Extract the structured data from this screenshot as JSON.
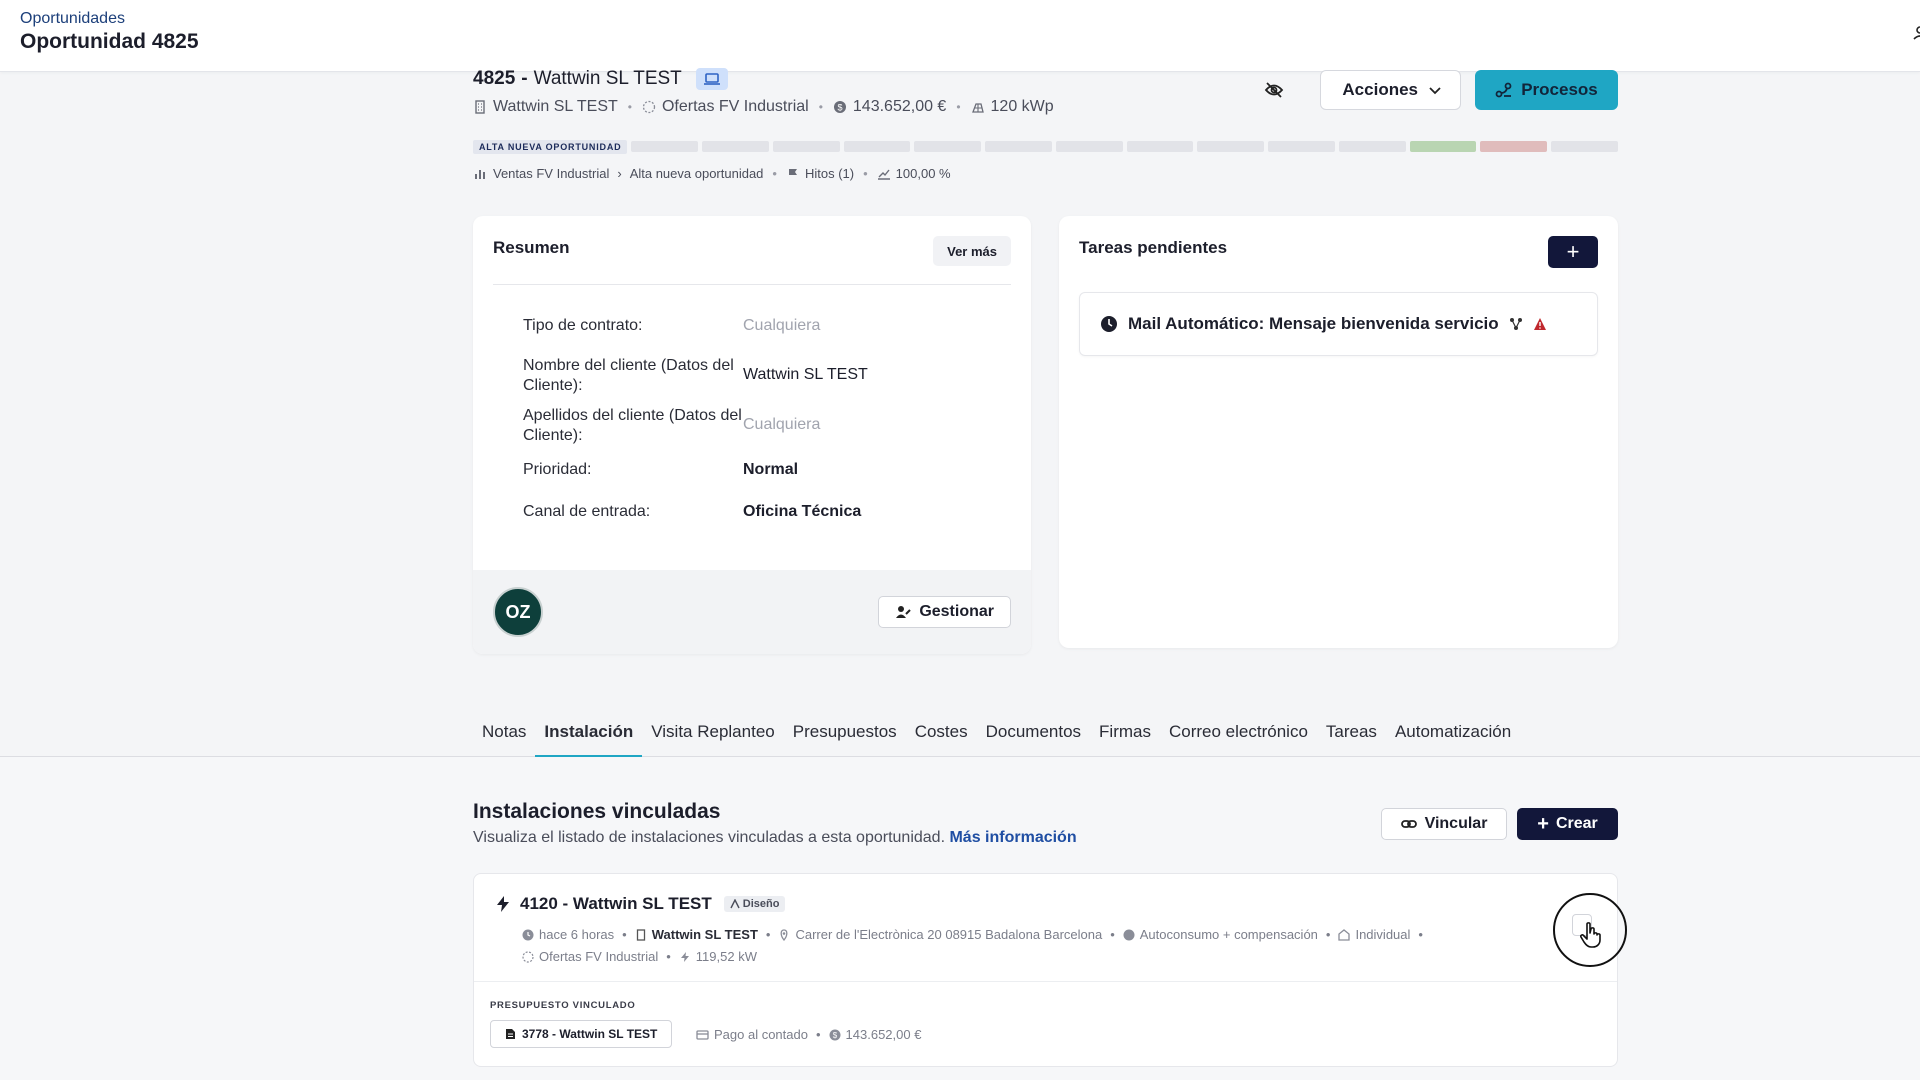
{
  "header": {
    "breadcrumb": "Oportunidades",
    "title": "Oportunidad 4825"
  },
  "opportunity": {
    "number": "4825",
    "name": "Wattwin SL TEST",
    "client": "Wattwin SL TEST",
    "catalog": "Ofertas FV Industrial",
    "amount": "143.652,00 €",
    "power": "120 kWp",
    "stage_label": "ALTA NUEVA OPORTUNIDAD",
    "stage_segments": [
      "#e2e3e8",
      "#e2e3e8",
      "#e2e3e8",
      "#e2e3e8",
      "#e2e3e8",
      "#e2e3e8",
      "#e2e3e8",
      "#e2e3e8",
      "#e2e3e8",
      "#e2e3e8",
      "#e2e3e8",
      "#b9d5b2",
      "#e0bcbc",
      "#e2e3e8"
    ],
    "pipeline": "Ventas FV Industrial",
    "pipeline_stage": "Alta nueva oportunidad",
    "milestones": "Hitos (1)",
    "probability": "100,00 %"
  },
  "actions": {
    "acciones": "Acciones",
    "procesos": "Procesos"
  },
  "resumen": {
    "title": "Resumen",
    "ver_mas": "Ver más",
    "fields": [
      {
        "label": "Tipo de contrato:",
        "value": "Cualquiera"
      },
      {
        "label": "Nombre del cliente (Datos del Cliente):",
        "value": "Wattwin SL TEST"
      },
      {
        "label": "Apellidos del cliente (Datos del Cliente):",
        "value": "Cualquiera"
      },
      {
        "label": "Prioridad:",
        "value": "Normal"
      },
      {
        "label": "Canal de entrada:",
        "value": "Oficina Técnica"
      }
    ],
    "avatar": "OZ",
    "gestionar": "Gestionar"
  },
  "tareas": {
    "title": "Tareas pendientes",
    "add": "+",
    "task": "Mail Automático: Mensaje bienvenida servicio"
  },
  "tabs": [
    "Notas",
    "Instalación",
    "Visita Replanteo",
    "Presupuestos",
    "Costes",
    "Documentos",
    "Firmas",
    "Correo electrónico",
    "Tareas",
    "Automatización"
  ],
  "active_tab": "Instalación",
  "instalaciones": {
    "title": "Instalaciones vinculadas",
    "subtitle": "Visualiza el listado de instalaciones vinculadas a esta oportunidad.",
    "more_info": "Más información",
    "vincular": "Vincular",
    "crear": "Crear",
    "item": {
      "title": "4120 - Wattwin SL TEST",
      "badge": "Diseño",
      "time": "hace 6 horas",
      "client": "Wattwin SL TEST",
      "address": "Carrer de l'Electrònica 20 08915 Badalona Barcelona",
      "mode": "Autoconsumo + compensación",
      "type": "Individual",
      "catalog": "Ofertas FV Industrial",
      "power": "119,52 kW",
      "budget_label": "PRESUPUESTO VINCULADO",
      "budget": "3778 - Wattwin SL TEST",
      "payment": "Pago al contado",
      "budget_amount": "143.652,00 €"
    }
  },
  "colors": {
    "primary_dark": "#12173a",
    "accent": "#1fa6c4",
    "link": "#1f4ea3",
    "warning": "#c0282d"
  }
}
